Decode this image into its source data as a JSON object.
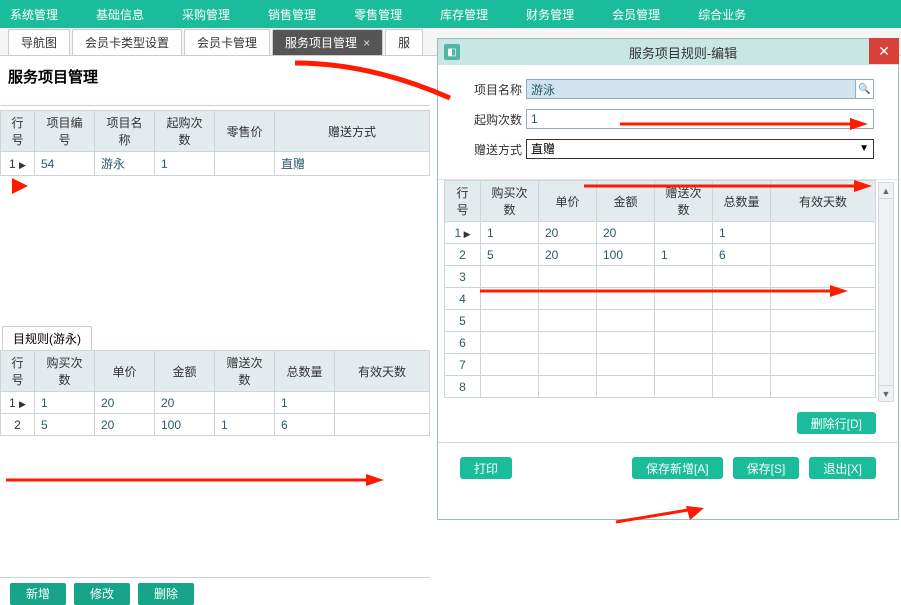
{
  "menu": {
    "items": [
      "系统管理",
      "基础信息",
      "采购管理",
      "销售管理",
      "零售管理",
      "库存管理",
      "财务管理",
      "会员管理",
      "综合业务"
    ]
  },
  "tabs": {
    "items": [
      {
        "label": "导航图",
        "active": false
      },
      {
        "label": "会员卡类型设置",
        "active": false
      },
      {
        "label": "会员卡管理",
        "active": false
      },
      {
        "label": "服务项目管理",
        "active": true,
        "closable": true
      },
      {
        "label": "服",
        "active": false
      }
    ]
  },
  "page": {
    "title": "服务项目管理"
  },
  "grid1": {
    "headers": [
      "行号",
      "项目编号",
      "项目名称",
      "起购次数",
      "零售价",
      "赠送方式"
    ],
    "rows": [
      {
        "no": "1",
        "cells": [
          "54",
          "游永",
          "1",
          "",
          "直赠"
        ],
        "indicator": true
      }
    ]
  },
  "rules_section": {
    "label": "目规则(游永)"
  },
  "grid2": {
    "headers": [
      "行号",
      "购买次数",
      "单价",
      "金额",
      "赠送次数",
      "总数量",
      "有效天数"
    ],
    "rows": [
      {
        "no": "1",
        "cells": [
          "1",
          "20",
          "20",
          "",
          "1",
          ""
        ],
        "indicator": true
      },
      {
        "no": "2",
        "cells": [
          "5",
          "20",
          "100",
          "1",
          "6",
          ""
        ]
      }
    ]
  },
  "bottom_buttons": {
    "add": "新增",
    "edit": "修改",
    "del": "删除"
  },
  "dialog": {
    "title": "服务项目规则-编辑",
    "form": {
      "name_label": "项目名称",
      "name_value": "游泳",
      "min_label": "起购次数",
      "min_value": "1",
      "gift_label": "赠送方式",
      "gift_value": "直赠"
    },
    "grid": {
      "headers": [
        "行号",
        "购买次数",
        "单价",
        "金额",
        "赠送次数",
        "总数量",
        "有效天数"
      ],
      "rows": [
        {
          "no": "1",
          "cells": [
            "1",
            "20",
            "20",
            "",
            "1",
            ""
          ],
          "indicator": true
        },
        {
          "no": "2",
          "cells": [
            "5",
            "20",
            "100",
            "1",
            "6",
            ""
          ]
        },
        {
          "no": "3",
          "cells": [
            "",
            "",
            "",
            "",
            "",
            ""
          ]
        },
        {
          "no": "4",
          "cells": [
            "",
            "",
            "",
            "",
            "",
            ""
          ]
        },
        {
          "no": "5",
          "cells": [
            "",
            "",
            "",
            "",
            "",
            ""
          ]
        },
        {
          "no": "6",
          "cells": [
            "",
            "",
            "",
            "",
            "",
            ""
          ]
        },
        {
          "no": "7",
          "cells": [
            "",
            "",
            "",
            "",
            "",
            ""
          ]
        },
        {
          "no": "8",
          "cells": [
            "",
            "",
            "",
            "",
            "",
            ""
          ]
        }
      ]
    },
    "buttons": {
      "delrow": "删除行[D]",
      "print": "打印",
      "save_new": "保存新增[A]",
      "save": "保存[S]",
      "exit": "退出[X]"
    }
  }
}
